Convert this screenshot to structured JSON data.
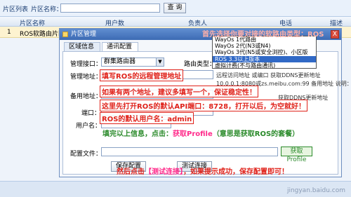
{
  "toolbar": {
    "list_title": "片区列表",
    "search_label": "片区名称：",
    "query_button": "查 询"
  },
  "grid": {
    "columns": [
      "片区名称",
      "用户数",
      "负责人",
      "电话",
      "描述"
    ],
    "row": {
      "index": "1",
      "name": "ROS软路由片区"
    }
  },
  "dialog": {
    "title": "片区管理",
    "close": "X",
    "tabs": [
      "区域信息",
      "通讯配置"
    ],
    "fields": {
      "mgmt_interface_label": "管理接口：",
      "mgmt_interface_value": "群集路由器",
      "router_type_label": "路由类型：",
      "mgmt_address_label": "管理地址：",
      "backup_address_label": "备用地址：",
      "port_label": "端口：",
      "username_label": "用户名：",
      "config_file_label": "配置文件："
    },
    "notes": {
      "n1": "远程访问地址 或编口 获取DDNS更新地址",
      "n2": "10.0.0.1:8080或zs.meibu.com:99 备用地址 说明：主",
      "n3": "获取DDNS更新地址"
    },
    "buttons": {
      "fetch_profile": "获取Profile",
      "save": "保存配置",
      "test": "测试连接"
    }
  },
  "dropdown": {
    "options": [
      "WayOs 1代路由",
      "WayOs 2代(N3或N4)",
      "WayOs 3代(N5或安全浏控)、小区版",
      "ROS 3.3以上版本",
      "虚拟计费(不与路由通讯)"
    ],
    "selected_index": 3
  },
  "annotations": {
    "top": "首先选择你要对接的软路由类型：ROS",
    "mgmt": "填写ROS的远程管理地址",
    "backup": "如果有两个地址，建议多填写一个，保证稳定性！",
    "port": "这里先打开ROS的默认API端口：8728，打开以后，为空就好！",
    "user": "ROS的默认用户名：admin",
    "profile_prefix": "填完以上信息，点击：",
    "profile_highlight": "获取Profile",
    "profile_suffix": "（意思是获取ROS的套餐）",
    "final_prefix": "然后点击",
    "final_highlight": "【测试连接】",
    "final_suffix": "，如果提示成功，保存配置即可！"
  },
  "watermark": "jingyan.baidu.com",
  "colors": {
    "annotation_red": "#e0221a",
    "annotation_green": "#2a8a2a",
    "highlight_pink": "#ff2a8a",
    "title_blue": "#3d6bb4"
  }
}
